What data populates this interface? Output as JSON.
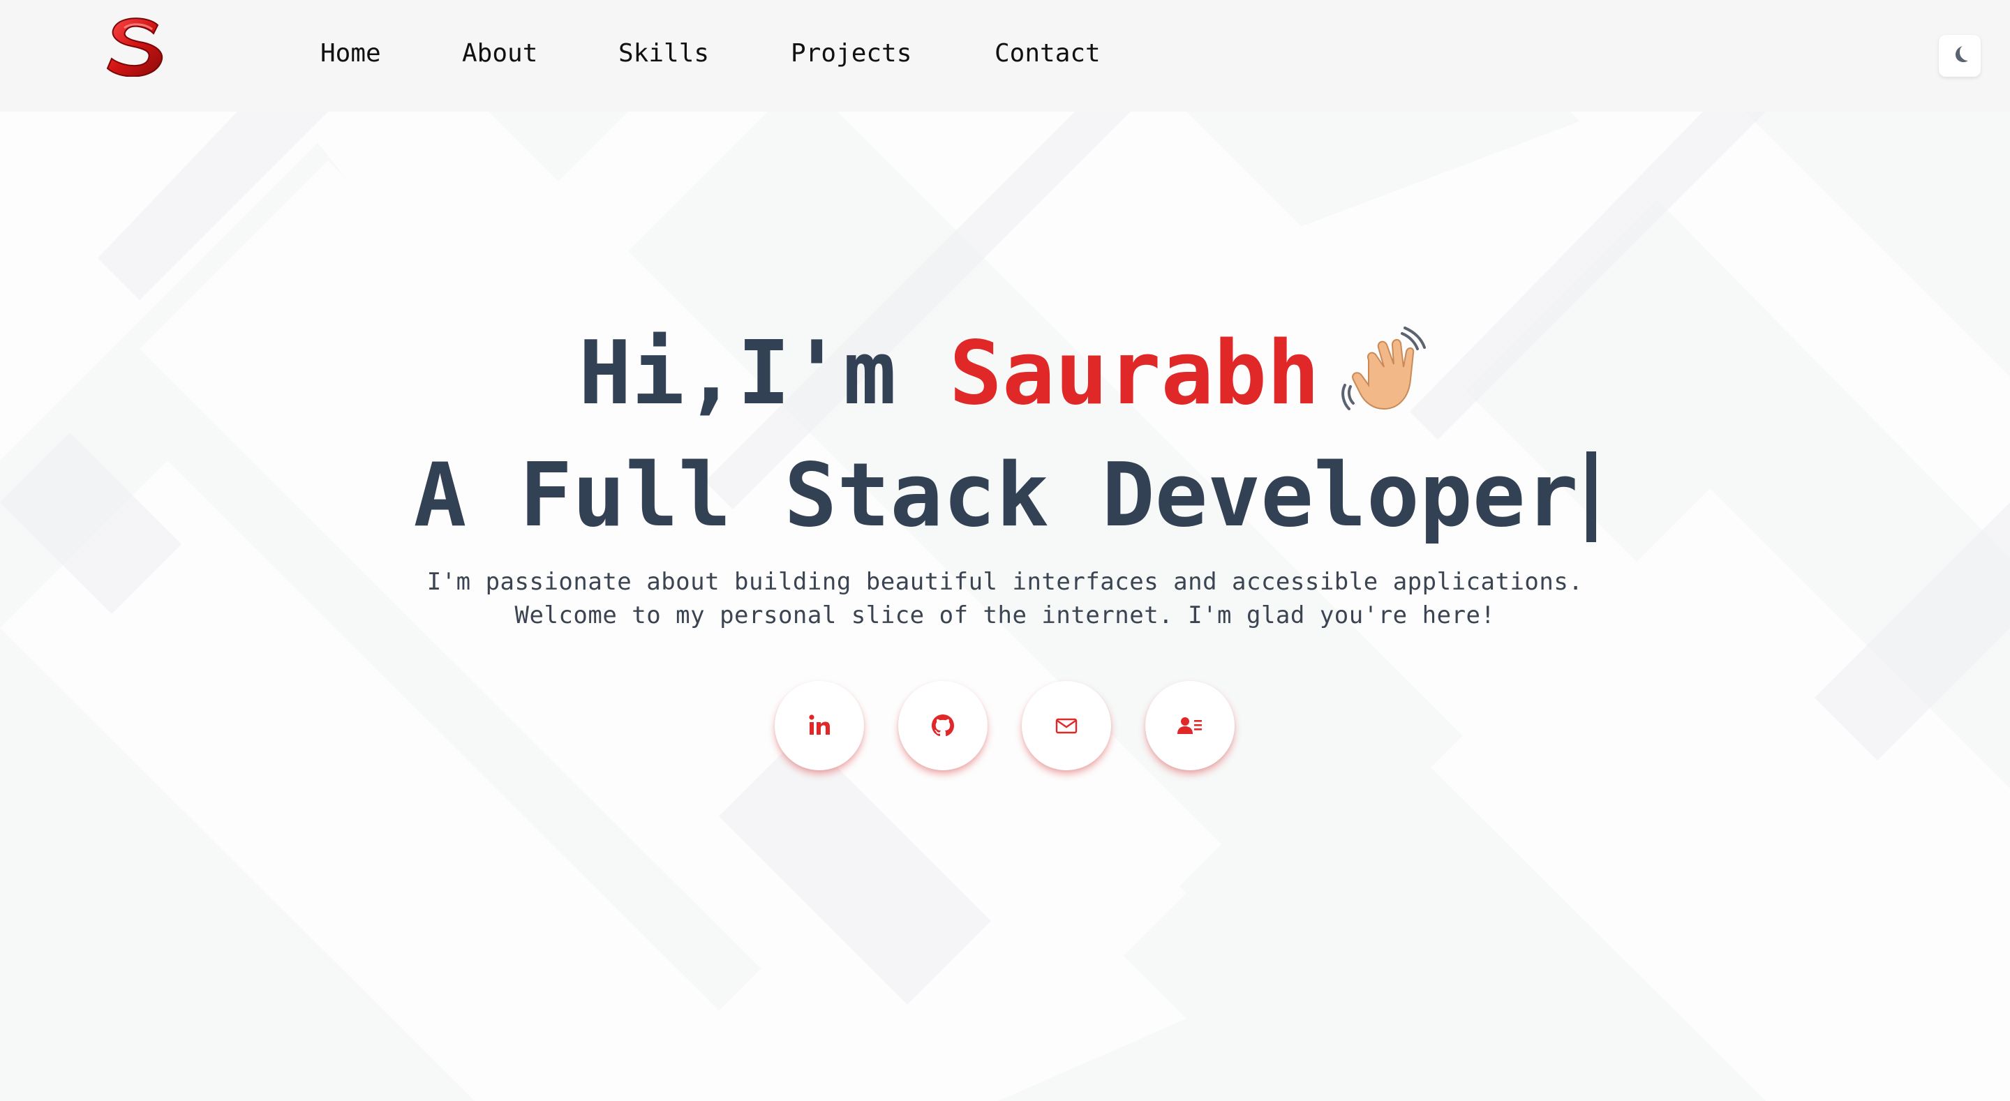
{
  "nav": {
    "logo_icon": "s-logo-icon",
    "links": [
      "Home",
      "About",
      "Skills",
      "Projects",
      "Contact"
    ],
    "theme_toggle_icon": "moon-icon"
  },
  "hero": {
    "greeting_prefix": "Hi,I'm ",
    "name": "Saurabh",
    "wave_icon": "waving-hand-icon",
    "role": "A Full Stack Developer",
    "tagline_line1": "I'm passionate about building beautiful interfaces and accessible applications.",
    "tagline_line2": "Welcome to my personal slice of the internet. I'm glad you're here!"
  },
  "socials": [
    {
      "icon": "linkedin-icon"
    },
    {
      "icon": "github-icon"
    },
    {
      "icon": "mail-icon"
    },
    {
      "icon": "contact-card-icon"
    }
  ],
  "colors": {
    "accent": "#e02828",
    "heading": "#334155",
    "background": "#f6f6f7"
  }
}
